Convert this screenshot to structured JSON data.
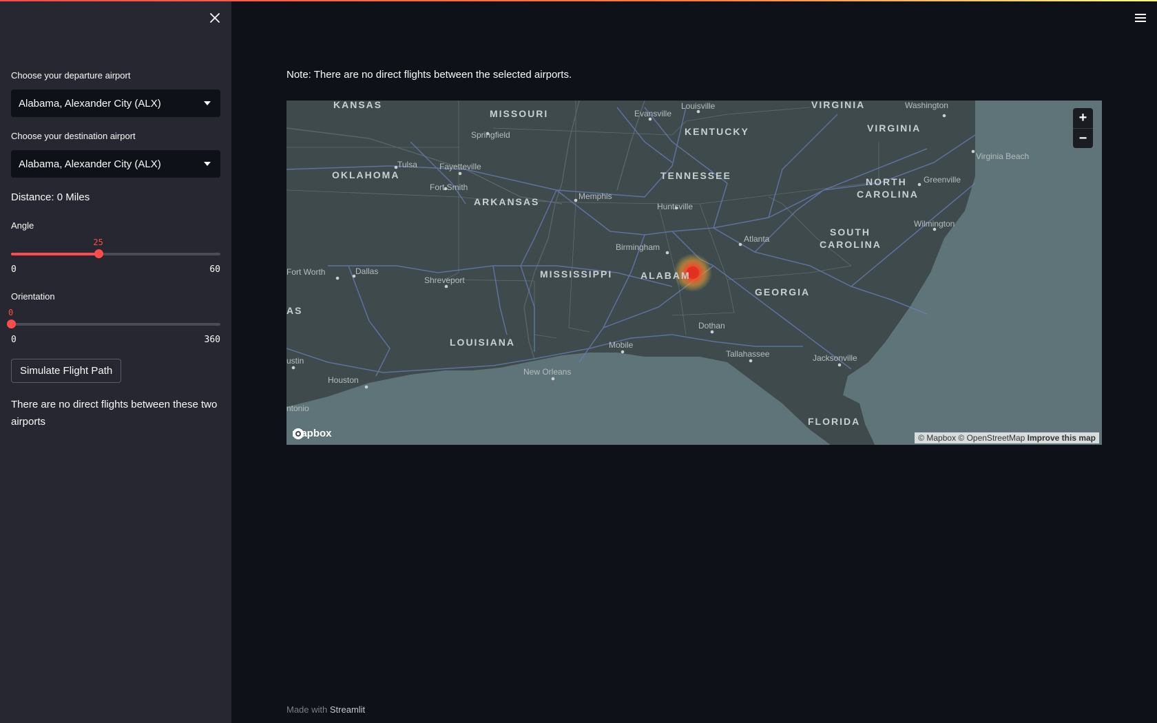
{
  "sidebar": {
    "departure_label": "Choose your departure airport",
    "departure_value": "Alabama, Alexander City (ALX)",
    "destination_label": "Choose your destination airport",
    "destination_value": "Alabama, Alexander City (ALX)",
    "distance_text": "Distance: 0 Miles",
    "angle": {
      "label": "Angle",
      "value": 25,
      "value_text": "25",
      "min": "0",
      "max": "60"
    },
    "orientation": {
      "label": "Orientation",
      "value": 0,
      "value_text": "0",
      "min": "0",
      "max": "360"
    },
    "simulate_button": "Simulate Flight Path",
    "message": "There are no direct flights between these two airports"
  },
  "main": {
    "note": "Note: There are no direct flights between the selected airports."
  },
  "map": {
    "states": [
      "KANSAS",
      "MISSOURI",
      "KENTUCKY",
      "VIRGINIA",
      "VIRGINIA",
      "OKLAHOMA",
      "TENNESSEE",
      "NORTH",
      "CAROLINA",
      "ARKANSAS",
      "SOUTH",
      "CAROLINA",
      "MISSISSIPPI",
      "ALABAM",
      "GEORGIA",
      "LOUISIANA",
      "FLORIDA",
      "AS"
    ],
    "cities": [
      "Louisville",
      "Evansville",
      "Washington",
      "Springfield",
      "Virginia Beach",
      "Tulsa",
      "Fayetteville",
      "Greenville",
      "Memphis",
      "Fort Smith",
      "Huntsville",
      "Wilmington",
      "Atlanta",
      "Birmingham",
      "Fort Worth",
      "Dallas",
      "Shreveport",
      "Dothan",
      "Mobile",
      "Tallahassee",
      "Jacksonville",
      "New Orleans",
      "Houston",
      "ustin",
      "ntonio"
    ],
    "zoom_in": "+",
    "zoom_out": "−",
    "logo": "mapbox",
    "attribution": "© Mapbox © OpenStreetMap",
    "improve": "Improve this map"
  },
  "footer": {
    "prefix": "Made with",
    "brand": "Streamlit"
  },
  "colors": {
    "accent": "#ff4b4b",
    "sidebar_bg": "#262730",
    "main_bg": "#0e1117",
    "water": "#5f7478"
  }
}
